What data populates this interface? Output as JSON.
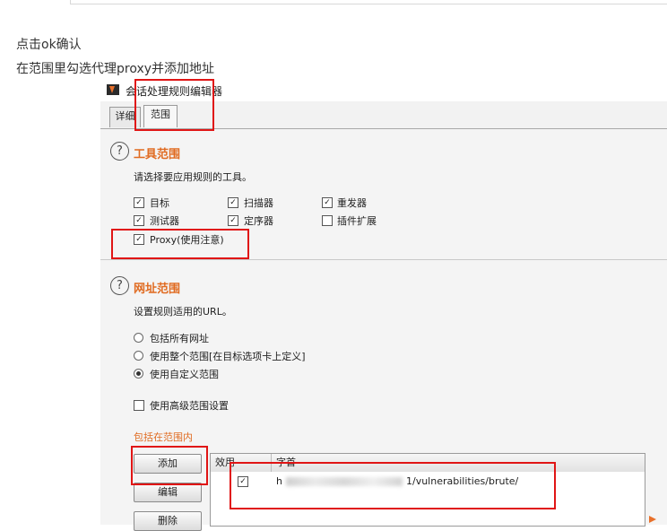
{
  "blog": {
    "line1": "点击ok确认",
    "line2": "在范围里勾选代理proxy并添加地址"
  },
  "window": {
    "title": "会话处理规则编辑器",
    "tabs": [
      {
        "label": "详细"
      },
      {
        "label": "范围"
      }
    ]
  },
  "tool_scope": {
    "title": "工具范围",
    "description": "请选择要应用规则的工具。",
    "tools": [
      {
        "label": "目标",
        "checked": true
      },
      {
        "label": "扫描器",
        "checked": true
      },
      {
        "label": "重发器",
        "checked": true
      },
      {
        "label": "测试器",
        "checked": true
      },
      {
        "label": "定序器",
        "checked": true
      },
      {
        "label": "插件扩展",
        "checked": false
      },
      {
        "label": "Proxy(使用注意)",
        "checked": true
      }
    ]
  },
  "url_scope": {
    "title": "网址范围",
    "description": "设置规则适用的URL。",
    "options": [
      {
        "label": "包括所有网址",
        "selected": false
      },
      {
        "label": "使用整个范围[在目标选项卡上定义]",
        "selected": false
      },
      {
        "label": "使用自定义范围",
        "selected": true
      }
    ],
    "advanced_label": "使用高级范围设置",
    "include_label": "包括在范围内",
    "buttons": {
      "add": "添加",
      "edit": "编辑",
      "remove": "删除"
    },
    "table": {
      "headers": [
        "效用",
        "字首"
      ],
      "rows": [
        {
          "enabled": true,
          "prefix_visible": "h",
          "prefix_suffix": "1/vulnerabilities/brute/"
        }
      ]
    }
  },
  "colors": {
    "accent": "#e06b21",
    "highlight": "#e01515"
  }
}
